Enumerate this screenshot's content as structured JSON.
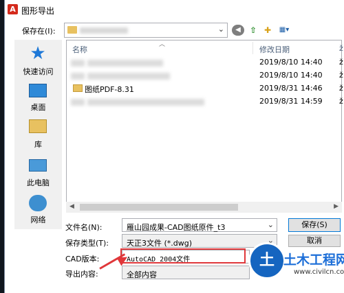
{
  "window": {
    "title": "图形导出",
    "app_icon": "A"
  },
  "toolbar": {
    "save_in_label": "保存在(I):",
    "icons": [
      "back-icon",
      "up-folder-icon",
      "new-folder-icon",
      "views-menu-icon"
    ]
  },
  "places": [
    {
      "label": "快速访问",
      "icon": "star-icon"
    },
    {
      "label": "桌面",
      "icon": "desktop-icon"
    },
    {
      "label": "库",
      "icon": "library-icon"
    },
    {
      "label": "此电脑",
      "icon": "computer-icon"
    },
    {
      "label": "网络",
      "icon": "network-icon"
    }
  ],
  "file_list": {
    "columns": {
      "name": "名称",
      "date": "修改日期",
      "type": "ž"
    },
    "rows": [
      {
        "name": "",
        "date": "2019/8/10 14:40",
        "type": "ž"
      },
      {
        "name": "",
        "date": "2019/8/10 14:40",
        "type": "ž"
      },
      {
        "name": "图纸PDF-8.31",
        "date": "2019/8/31 14:46",
        "type": "ž"
      },
      {
        "name": "",
        "date": "2019/8/31 14:59",
        "type": "ž"
      }
    ]
  },
  "form": {
    "filename_label": "文件名(N):",
    "filename_value": "雁山园成果-CAD图纸原件_t3",
    "filetype_label": "保存类型(T):",
    "filetype_value": "天正3文件 (*.dwg)",
    "cad_version_label": "CAD版本:",
    "cad_version_value": "AutoCAD 2004文件",
    "export_content_label": "导出内容:",
    "export_content_value": "全部内容"
  },
  "buttons": {
    "save": "保存(S)",
    "cancel": "取消"
  },
  "watermark": {
    "title": "土木工程网",
    "url": "www.civilcn.com",
    "badge": "土"
  },
  "colors": {
    "annotation_red": "#e0373a",
    "folder_yellow": "#e8c160",
    "accent_blue": "#0078d7"
  }
}
